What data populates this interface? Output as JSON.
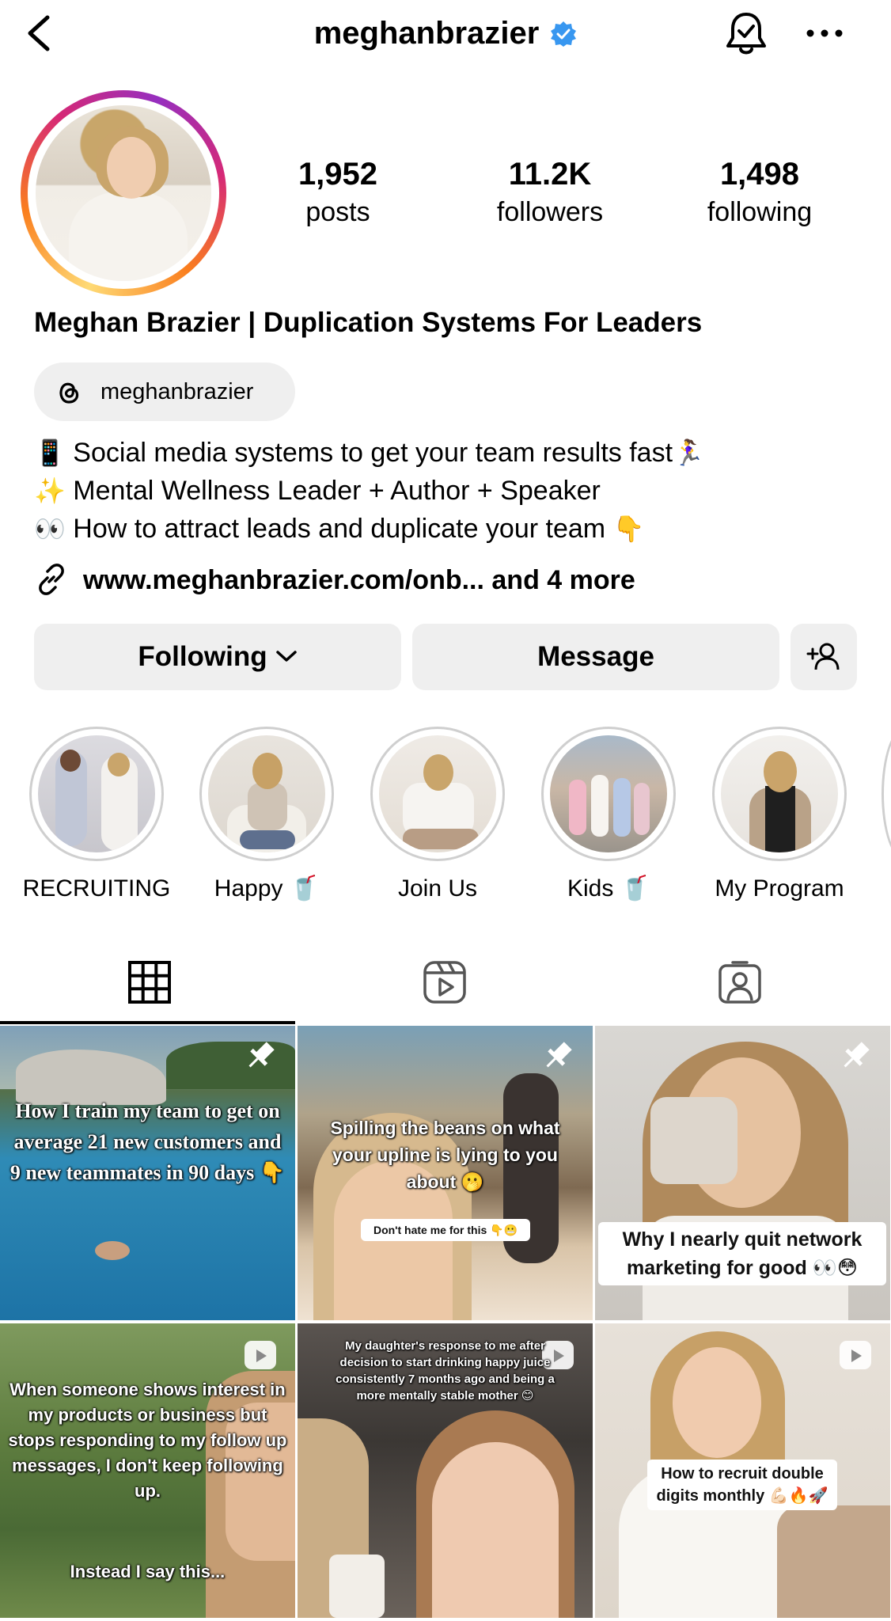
{
  "header": {
    "username": "meghanbrazier",
    "verified_color": "#3897f0"
  },
  "profile": {
    "stats": [
      {
        "value": "1,952",
        "label": "posts"
      },
      {
        "value": "11.2K",
        "label": "followers"
      },
      {
        "value": "1,498",
        "label": "following"
      }
    ],
    "full_name": "Meghan Brazier | Duplication Systems For Leaders",
    "threads_handle": "meghanbrazier",
    "bio": [
      {
        "emoji": "📱",
        "text": "Social media systems to get your team results fast",
        "trail": "🏃‍♀️"
      },
      {
        "emoji": "✨",
        "text": "Mental Wellness Leader + Author + Speaker",
        "trail": ""
      },
      {
        "emoji": "👀",
        "text": "How to attract leads and duplicate your team",
        "trail": "👇"
      }
    ],
    "link_text": "www.meghanbrazier.com/onb...  and 4 more"
  },
  "actions": {
    "following_label": "Following",
    "message_label": "Message"
  },
  "highlights": [
    {
      "label": "RECRUITING"
    },
    {
      "label": "Happy 🥤"
    },
    {
      "label": "Join Us"
    },
    {
      "label": "Kids 🥤"
    },
    {
      "label": "My Program"
    }
  ],
  "tabs": [
    "grid-icon",
    "reels-icon",
    "tagged-icon"
  ],
  "posts": [
    {
      "text": "How I train my team to get on average 21 new customers and 9 new teammates in 90 days 👇",
      "pinned": true
    },
    {
      "text": "Spilling the beans on what your upline is lying to you about 🫢",
      "caption": "Don't hate me for this 👇😬",
      "pinned": true
    },
    {
      "text": "Why I nearly quit network marketing for good 👀😳",
      "pinned": true
    },
    {
      "text": "When someone shows interest in my products or business but stops responding to my follow up messages, I don't keep following up.",
      "text2": "Instead I say this...",
      "reel": true
    },
    {
      "text": "My daughter's response to me after decision to start drinking happy juice consistently 7 months ago and being a more mentally stable mother 😊",
      "reel": true
    },
    {
      "text": "How to recruit double digits monthly 💪🏻🔥🚀",
      "reel": true
    }
  ]
}
